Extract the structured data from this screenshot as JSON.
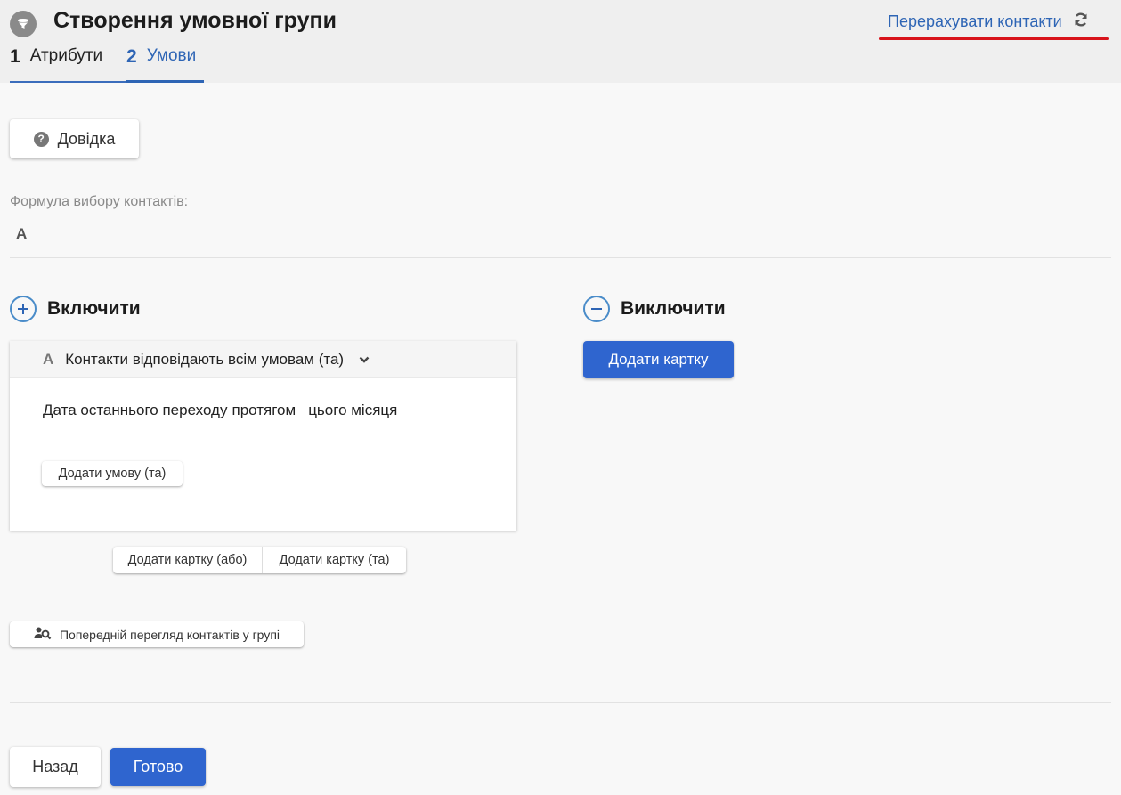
{
  "header": {
    "title": "Створення умовної групи",
    "recalc_label": "Перерахувати контакти",
    "steps": [
      {
        "num": "1",
        "label": "Атрибути"
      },
      {
        "num": "2",
        "label": "Умови"
      }
    ]
  },
  "help": {
    "label": "Довідка"
  },
  "formula": {
    "label": "Формула вибору контактів:",
    "value": "A"
  },
  "include": {
    "title": "Включити",
    "card": {
      "letter": "A",
      "title": "Контакти відповідають всім умовам (та)",
      "condition": {
        "field": "Дата останнього переходу",
        "operator": "протягом",
        "value": "цього місяця"
      },
      "add_condition_label": "Додати умову (та)"
    },
    "add_card_or_label": "Додати картку (або)",
    "add_card_and_label": "Додати картку (та)"
  },
  "exclude": {
    "title": "Виключити",
    "add_card_label": "Додати картку"
  },
  "preview": {
    "label": "Попередній перегляд контактів у групі"
  },
  "footer": {
    "back_label": "Назад",
    "done_label": "Готово"
  },
  "colors": {
    "accent": "#2f65cf",
    "link": "#2e65b5",
    "highlight_underline": "#d8131b"
  }
}
